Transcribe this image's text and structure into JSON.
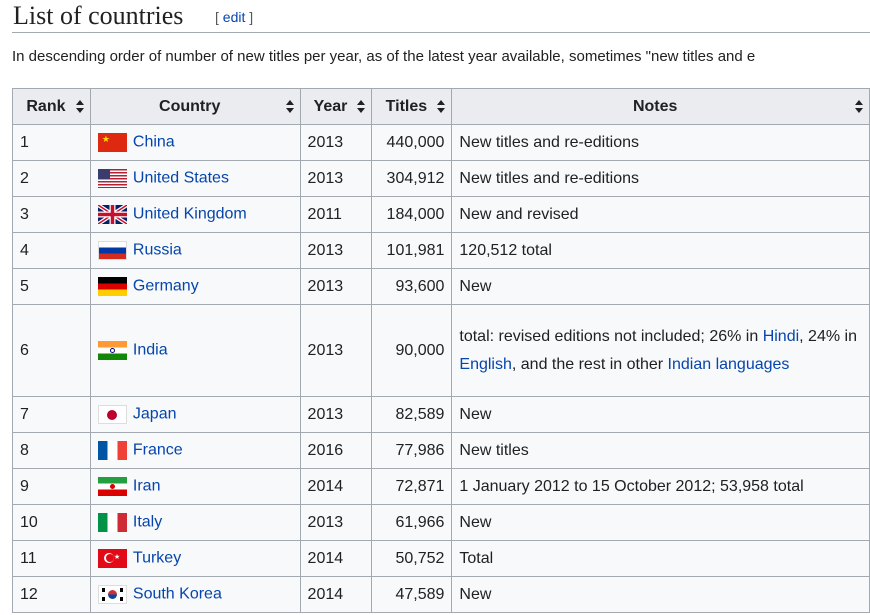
{
  "section": {
    "title": "List of countries",
    "edit_open": "[ ",
    "edit_label": "edit",
    "edit_close": " ]"
  },
  "intro": "In descending order of number of new titles per year, as of the latest year available, sometimes \"new titles and e",
  "table": {
    "headers": {
      "rank": "Rank",
      "country": "Country",
      "year": "Year",
      "titles": "Titles",
      "notes": "Notes"
    },
    "rows": [
      {
        "rank": "1",
        "country": "China",
        "flag": "china-flag-icon",
        "year": "2013",
        "titles": "440,000",
        "notes": "New titles and re-editions"
      },
      {
        "rank": "2",
        "country": "United States",
        "flag": "united-states-flag-icon",
        "year": "2013",
        "titles": "304,912",
        "notes": "New titles and re-editions"
      },
      {
        "rank": "3",
        "country": "United Kingdom",
        "flag": "united-kingdom-flag-icon",
        "year": "2011",
        "titles": "184,000",
        "notes": "New and revised"
      },
      {
        "rank": "4",
        "country": "Russia",
        "flag": "russia-flag-icon",
        "year": "2013",
        "titles": "101,981",
        "notes": "120,512 total"
      },
      {
        "rank": "5",
        "country": "Germany",
        "flag": "germany-flag-icon",
        "year": "2013",
        "titles": "93,600",
        "notes": "New"
      },
      {
        "rank": "6",
        "country": "India",
        "flag": "india-flag-icon",
        "year": "2013",
        "titles": "90,000",
        "notes_parts": {
          "a": "total: revised editions not included; 26% in ",
          "hindi": "Hindi",
          "b": ", 24% in ",
          "english": "English",
          "c": ", and the rest in other ",
          "indian_languages": "Indian languages"
        }
      },
      {
        "rank": "7",
        "country": "Japan",
        "flag": "japan-flag-icon",
        "year": "2013",
        "titles": "82,589",
        "notes": "New"
      },
      {
        "rank": "8",
        "country": "France",
        "flag": "france-flag-icon",
        "year": "2016",
        "titles": "77,986",
        "notes": "New titles"
      },
      {
        "rank": "9",
        "country": "Iran",
        "flag": "iran-flag-icon",
        "year": "2014",
        "titles": "72,871",
        "notes": "1 January 2012 to 15 October 2012; 53,958 total"
      },
      {
        "rank": "10",
        "country": "Italy",
        "flag": "italy-flag-icon",
        "year": "2013",
        "titles": "61,966",
        "notes": "New"
      },
      {
        "rank": "11",
        "country": "Turkey",
        "flag": "turkey-flag-icon",
        "year": "2014",
        "titles": "50,752",
        "notes": "Total"
      },
      {
        "rank": "12",
        "country": "South Korea",
        "flag": "south-korea-flag-icon",
        "year": "2014",
        "titles": "47,589",
        "notes": "New"
      }
    ]
  }
}
